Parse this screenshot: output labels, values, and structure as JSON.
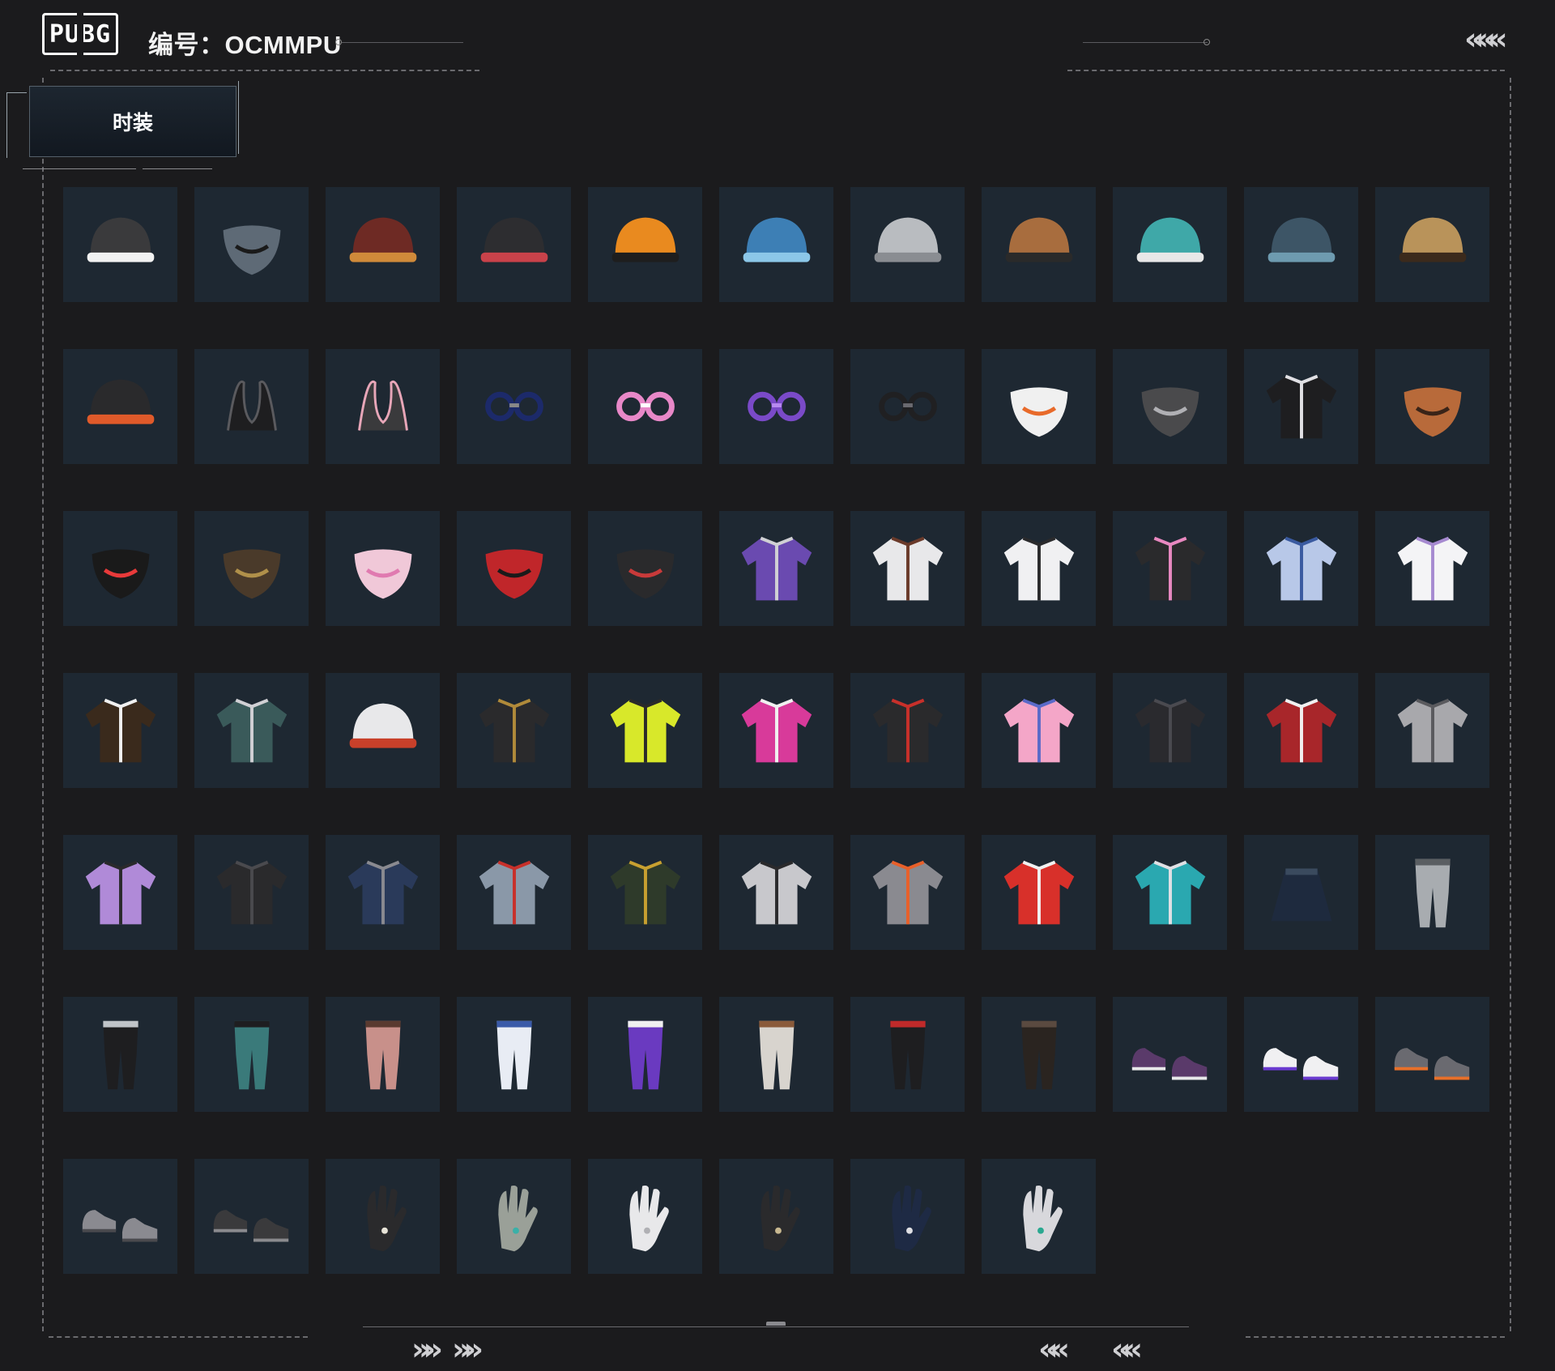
{
  "header": {
    "logo_text": "PUBG",
    "code_label": "编号：OCMMPU"
  },
  "tab": {
    "label": "时装"
  },
  "chevrons": {
    "top_right": "«««",
    "bottom_left_a": "»»",
    "bottom_left_b": "»»",
    "bottom_right_a": "««",
    "bottom_right_b": "««"
  },
  "items": [
    {
      "icon": "penguin-beanie-icon",
      "color": "#3a3a3c",
      "accent": "#f2f2f2"
    },
    {
      "icon": "balaclava-goggles-icon",
      "color": "#5e6a76",
      "accent": "#1a1a1a"
    },
    {
      "icon": "roast-chicken-hat-icon",
      "color": "#6e2a24",
      "accent": "#d08a3a"
    },
    {
      "icon": "top-hat-icon",
      "color": "#2d2d30",
      "accent": "#c9424a"
    },
    {
      "icon": "orange-beanie-icon",
      "color": "#e98a1f",
      "accent": "#1e1e1e"
    },
    {
      "icon": "blue-beret-icon",
      "color": "#3d7fb5",
      "accent": "#8cc7e8"
    },
    {
      "icon": "white-bucket-hat-icon",
      "color": "#b9bcc0",
      "accent": "#8a8d92"
    },
    {
      "icon": "aviator-cap-icon",
      "color": "#a86d3e",
      "accent": "#2a2a2a"
    },
    {
      "icon": "cat-ear-hood-icon",
      "color": "#3fa8a8",
      "accent": "#e8e8e8"
    },
    {
      "icon": "teal-bucket-hat-icon",
      "color": "#3d5566",
      "accent": "#6e9bb0"
    },
    {
      "icon": "leopard-bucket-hat-icon",
      "color": "#b9935a",
      "accent": "#3b2a1c"
    },
    {
      "icon": "black-cap-icon",
      "color": "#2a2a2c",
      "accent": "#e05a2a"
    },
    {
      "icon": "black-horns-icon",
      "color": "#1e1e20",
      "accent": "#5a5a5e"
    },
    {
      "icon": "bunny-ears-icon",
      "color": "#3a3a3c",
      "accent": "#e8a6b8"
    },
    {
      "icon": "navy-sunglasses-icon",
      "color": "#1c2a6a",
      "accent": "#888"
    },
    {
      "icon": "pink-round-glasses-icon",
      "color": "#e888c8",
      "accent": "#ffffff"
    },
    {
      "icon": "purple-visor-icon",
      "color": "#7a4ac8",
      "accent": "#b88af0"
    },
    {
      "icon": "sport-sunglasses-icon",
      "color": "#202022",
      "accent": "#6a6a70"
    },
    {
      "icon": "snowman-bandana-icon",
      "color": "#f0f0f0",
      "accent": "#e86a2a"
    },
    {
      "icon": "gas-mask-icon",
      "color": "#4a4a4c",
      "accent": "#b0b0b4"
    },
    {
      "icon": "respirator-headset-icon",
      "color": "#1e1e20",
      "accent": "#e0e0e4"
    },
    {
      "icon": "chimp-mask-icon",
      "color": "#b86a3a",
      "accent": "#3a2418"
    },
    {
      "icon": "joker-face-mask-icon",
      "color": "#1a1a1a",
      "accent": "#e83a3a"
    },
    {
      "icon": "camo-scarf-icon",
      "color": "#4a3a2a",
      "accent": "#b0904a"
    },
    {
      "icon": "pink-face-mask-icon",
      "color": "#f0c8d8",
      "accent": "#e07ab0"
    },
    {
      "icon": "red-demon-mask-icon",
      "color": "#c0262a",
      "accent": "#1a1a1a"
    },
    {
      "icon": "black-tactical-mask-icon",
      "color": "#2a2a2c",
      "accent": "#c83a3a"
    },
    {
      "icon": "purple-outfit-icon",
      "color": "#6a4ab0",
      "accent": "#d0d0d4"
    },
    {
      "icon": "bunny-suit-icon",
      "color": "#e8e8ea",
      "accent": "#6a3a2a"
    },
    {
      "icon": "white-shirt-vest-icon",
      "color": "#f0f0f2",
      "accent": "#2a2a2c"
    },
    {
      "icon": "pink-black-jacket-icon",
      "color": "#2a2a2c",
      "accent": "#e888c0"
    },
    {
      "icon": "blue-floral-top-icon",
      "color": "#b8c8e8",
      "accent": "#3a5aa0"
    },
    {
      "icon": "cat-tshirt-icon",
      "color": "#f4f4f6",
      "accent": "#a68ad0"
    },
    {
      "icon": "chest-rig-top-icon",
      "color": "#3a2a1c",
      "accent": "#f0f0f0"
    },
    {
      "icon": "floral-shirt-icon",
      "color": "#3a5a5a",
      "accent": "#d0d0d4"
    },
    {
      "icon": "hooded-vest-icon",
      "color": "#e8e8ea",
      "accent": "#c8402a"
    },
    {
      "icon": "black-gold-jacket-icon",
      "color": "#2a2a2c",
      "accent": "#b08a3a"
    },
    {
      "icon": "yellow-jersey-icon",
      "color": "#d8e82a",
      "accent": "#2a2a2a"
    },
    {
      "icon": "magenta-jersey-icon",
      "color": "#d83a9a",
      "accent": "#f0f0f0"
    },
    {
      "icon": "red-floral-dress-icon",
      "color": "#2a2a2c",
      "accent": "#c8302a"
    },
    {
      "icon": "anime-pink-tshirt-icon",
      "color": "#f4a6c8",
      "accent": "#5a6ac8"
    },
    {
      "icon": "black-coat-icon",
      "color": "#2a2a2e",
      "accent": "#4a4a50"
    },
    {
      "icon": "red-blazer-icon",
      "color": "#a8262a",
      "accent": "#f0f0f0"
    },
    {
      "icon": "grey-camo-hoodie-icon",
      "color": "#a8a8ac",
      "accent": "#5a5a5e"
    },
    {
      "icon": "purple-devil-hoodie-icon",
      "color": "#b08ad8",
      "accent": "#2a2a2c"
    },
    {
      "icon": "black-tactical-top-icon",
      "color": "#2a2a2c",
      "accent": "#4a4a4e"
    },
    {
      "icon": "navy-jacket-icon",
      "color": "#2a3a5a",
      "accent": "#8a8a90"
    },
    {
      "icon": "grey-track-jacket-icon",
      "color": "#8a98a8",
      "accent": "#c8302a"
    },
    {
      "icon": "green-bomber-icon",
      "color": "#2e3a2a",
      "accent": "#c8a030"
    },
    {
      "icon": "silver-jacket-icon",
      "color": "#c8c8cc",
      "accent": "#2a2a2c"
    },
    {
      "icon": "grey-orange-jacket-icon",
      "color": "#8a8a90",
      "accent": "#e8602a"
    },
    {
      "icon": "red-varsity-jacket-icon",
      "color": "#d8302a",
      "accent": "#f0f0f0"
    },
    {
      "icon": "teal-windbreaker-icon",
      "color": "#2aa8b0",
      "accent": "#e0e0e4"
    },
    {
      "icon": "navy-skirt-icon",
      "color": "#1e2a3e",
      "accent": "#3a4a5e"
    },
    {
      "icon": "grey-camo-pants-icon",
      "color": "#a8acb0",
      "accent": "#5a5e62"
    },
    {
      "icon": "grey-black-leggings-icon",
      "color": "#1e1e20",
      "accent": "#c0c4c8"
    },
    {
      "icon": "teal-shorts-leggings-icon",
      "color": "#3a7a7a",
      "accent": "#1e1e20"
    },
    {
      "icon": "pink-cargo-pants-icon",
      "color": "#c8908a",
      "accent": "#5a3a30"
    },
    {
      "icon": "blue-floral-shorts-icon",
      "color": "#e8ecf4",
      "accent": "#3a5aa8"
    },
    {
      "icon": "purple-white-leggings-icon",
      "color": "#6a3ac0",
      "accent": "#f0f0f0"
    },
    {
      "icon": "white-shorts-icon",
      "color": "#d8d4ce",
      "accent": "#8a5a3a"
    },
    {
      "icon": "thigh-high-socks-icon",
      "color": "#1e1e20",
      "accent": "#c02a2a"
    },
    {
      "icon": "black-long-boots-icon",
      "color": "#2a2420",
      "accent": "#5a4a40"
    },
    {
      "icon": "purple-sneakers-icon",
      "color": "#5a3a6a",
      "accent": "#e8e8ea"
    },
    {
      "icon": "white-purple-sneakers-icon",
      "color": "#f0f0f2",
      "accent": "#6a3ad0"
    },
    {
      "icon": "grey-orange-sneakers-icon",
      "color": "#6a6a70",
      "accent": "#e8702a"
    },
    {
      "icon": "grey-shoes-icon",
      "color": "#8a8a90",
      "accent": "#4a4a4e"
    },
    {
      "icon": "black-sneakers-icon",
      "color": "#3a3a3c",
      "accent": "#8a8a8e"
    },
    {
      "icon": "skeleton-gloves-icon",
      "color": "#2a2a2c",
      "accent": "#e8e4d8"
    },
    {
      "icon": "grey-glove-ring-icon",
      "color": "#9aa098",
      "accent": "#3ab0a8"
    },
    {
      "icon": "white-gloves-icon",
      "color": "#e8e8ea",
      "accent": "#b0b0b4"
    },
    {
      "icon": "black-skeleton-gloves-icon",
      "color": "#2a2a2c",
      "accent": "#c8b890"
    },
    {
      "icon": "navy-black-gloves-icon",
      "color": "#1e2a44",
      "accent": "#e0e0e4"
    },
    {
      "icon": "pale-hand-rings-icon",
      "color": "#d8d8dc",
      "accent": "#2aa890"
    }
  ]
}
